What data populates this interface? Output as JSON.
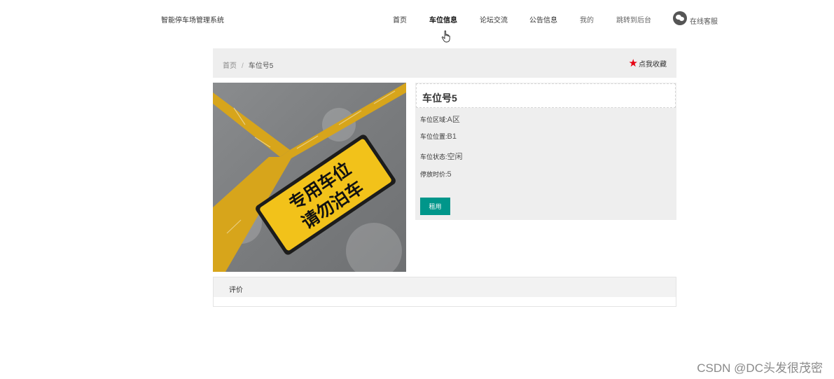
{
  "header": {
    "site_title": "智能停车场管理系统",
    "nav": [
      {
        "label": "首页"
      },
      {
        "label": "车位信息",
        "active": true
      },
      {
        "label": "论坛交流"
      },
      {
        "label": "公告信息"
      },
      {
        "label": "我的"
      },
      {
        "label": "跳转到后台"
      }
    ],
    "service_label": "在线客服",
    "service_icon": "wechat-icon"
  },
  "breadcrumb": {
    "home": "首页",
    "separator": "/",
    "current": "车位号5"
  },
  "favorite": {
    "icon": "star-icon",
    "star_color": "#e60012",
    "label": "点我收藏"
  },
  "photo": {
    "sign_line1": "专用车位",
    "sign_line2": "请勿泊车"
  },
  "detail": {
    "title": "车位号5",
    "fields": [
      {
        "label": "车位区域:",
        "value": "A区"
      },
      {
        "label": "车位位置:",
        "value": "B1"
      },
      {
        "label": "车位状态:",
        "value": "空闲"
      },
      {
        "label": "停放时价:",
        "value": "5"
      }
    ],
    "rent_button": "租用",
    "accent_color": "#00968a"
  },
  "review": {
    "tab_label": "评价"
  },
  "watermark": "CSDN @DC头发很茂密"
}
